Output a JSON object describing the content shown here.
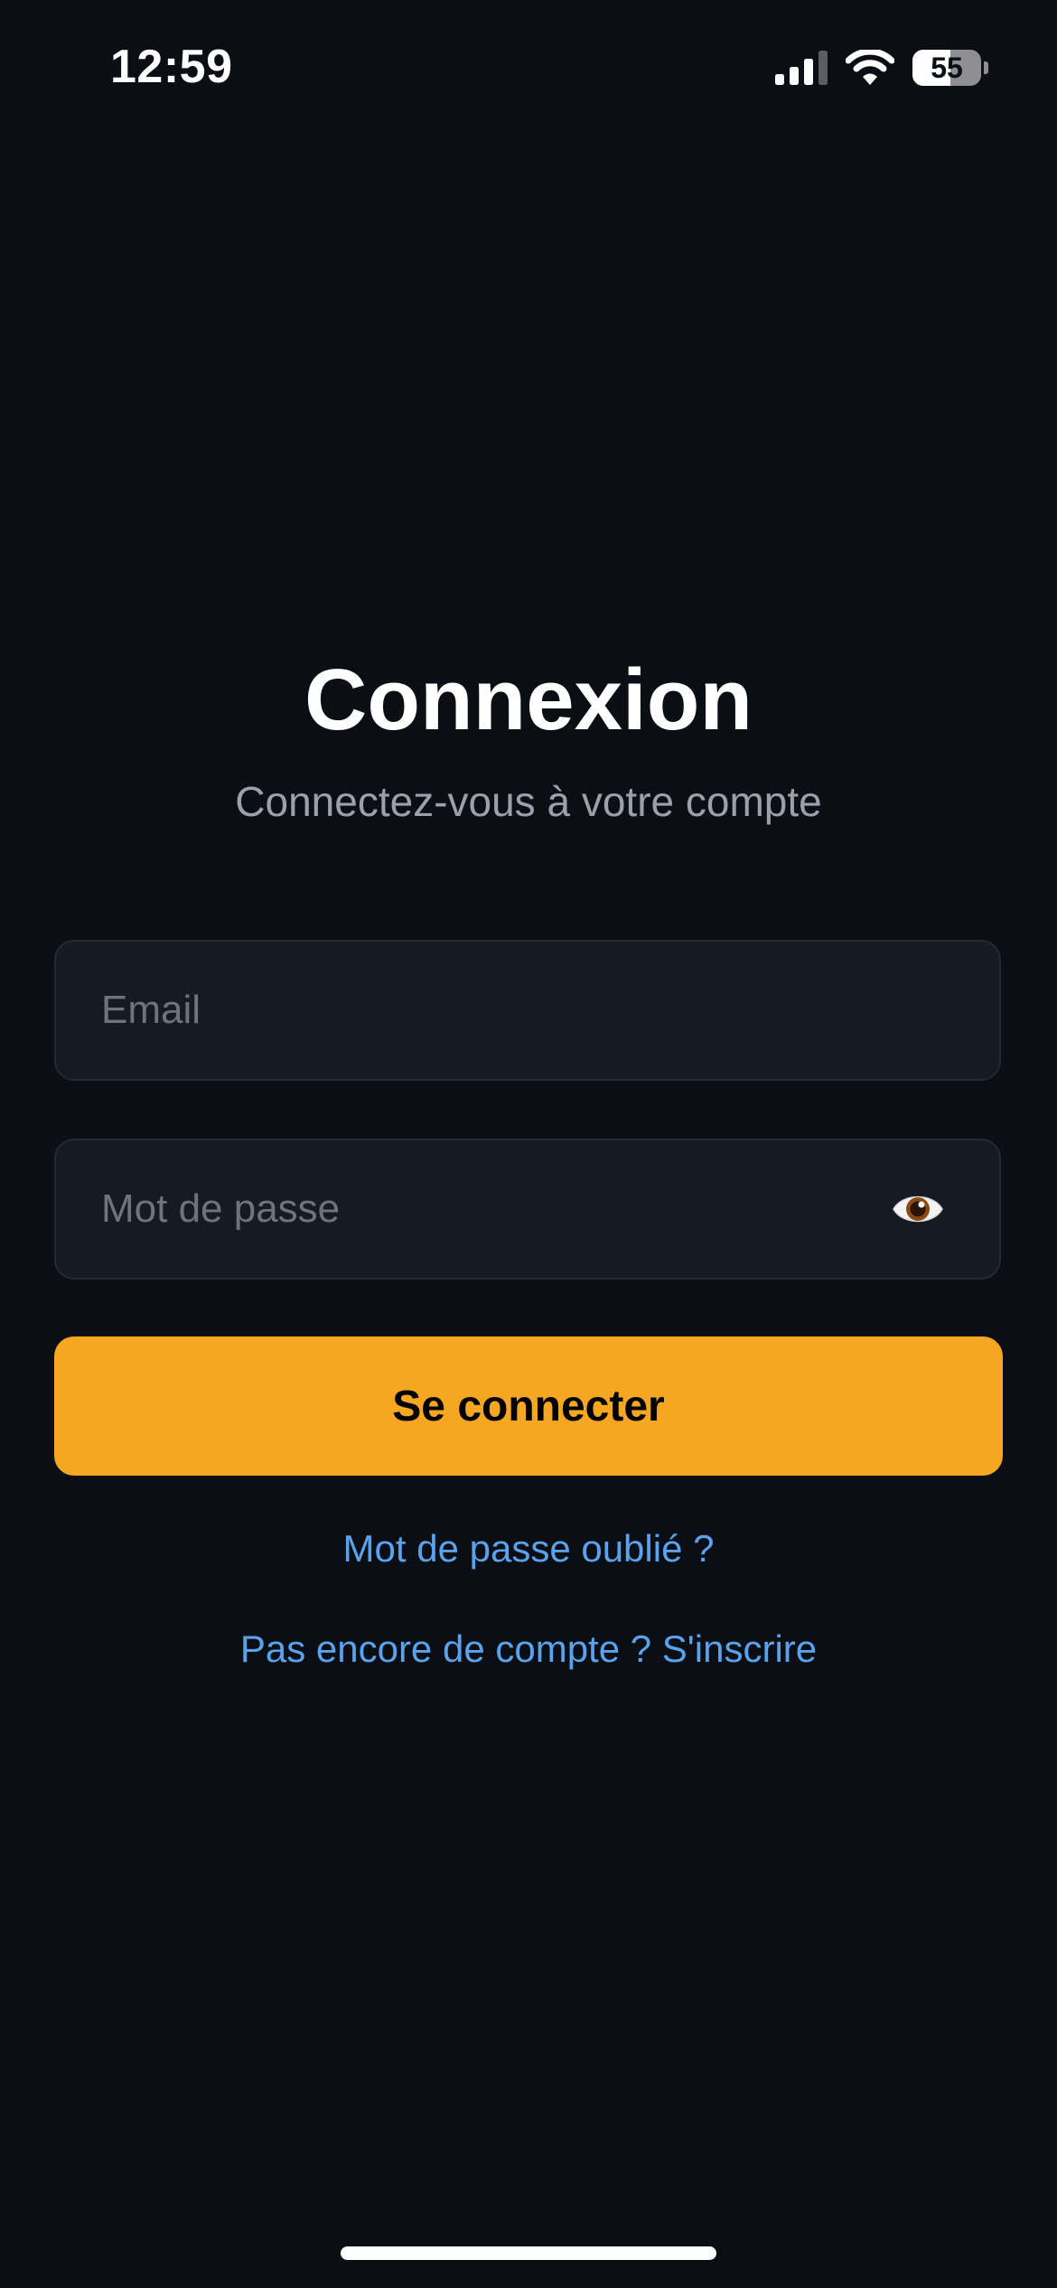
{
  "status_bar": {
    "time": "12:59",
    "battery_percent": "55",
    "battery_level": 0.55,
    "signal_icon": "cellular-signal-icon",
    "wifi_icon": "wifi-icon"
  },
  "login": {
    "title": "Connexion",
    "subtitle": "Connectez-vous à votre compte",
    "email": {
      "placeholder": "Email",
      "value": ""
    },
    "password": {
      "placeholder": "Mot de passe",
      "value": "",
      "toggle_icon": "eye-icon"
    },
    "submit_label": "Se connecter",
    "forgot_password_label": "Mot de passe oublié ?",
    "signup_label": "Pas encore de compte ? S'inscrire"
  },
  "colors": {
    "background": "#0b0e15",
    "accent": "#f5a623",
    "link": "#5aa3ec",
    "field_background": "#161a22"
  }
}
